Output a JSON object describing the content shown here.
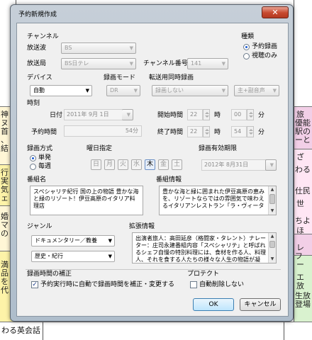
{
  "background": {
    "left_cells": [
      "神",
      "ヌ",
      "首",
      "、",
      "結",
      "行",
      "実",
      "気",
      "ェ",
      "婚",
      "マ",
      "の",
      "満",
      "品",
      "を",
      "代"
    ],
    "right_cells": [
      "旅",
      "優能",
      "駅の",
      "ーと",
      "ざ",
      "わる",
      "仕民",
      "世",
      "ちよ",
      "ほ",
      "レ",
      "フ",
      "ー",
      "エ",
      "放",
      "生放",
      "登場"
    ],
    "footer": "わる英会話"
  },
  "dialog": {
    "title": "予約新規作成",
    "close_label": "✕",
    "channel": {
      "group_label": "チャンネル",
      "broadcast_wave_label": "放送波",
      "broadcast_wave_value": "BS",
      "station_label": "放送局",
      "station_value": "BS日テレ",
      "channel_number_label": "チャンネル番号",
      "channel_number_value": "141"
    },
    "kind": {
      "group_label": "種類",
      "options": [
        "予約録画",
        "視聴のみ"
      ],
      "selected": 0
    },
    "device": {
      "group_label": "デバイス",
      "value": "自動"
    },
    "record_mode": {
      "group_label": "録画モード",
      "value": "DR"
    },
    "transfer": {
      "group_label": "転送用同時録画",
      "value": "録画しない",
      "audio_value": "主+副音声"
    },
    "time": {
      "group_label": "時刻",
      "date_label": "日付",
      "date_value": "2011年 9月 1日",
      "start_label": "開始時間",
      "start_hour": "22",
      "start_minute": "00",
      "hour_unit": "時",
      "minute_unit": "分",
      "duration_label": "予約時間",
      "duration_value": "54分",
      "end_label": "終了時間",
      "end_hour": "22",
      "end_minute": "54"
    },
    "record_method": {
      "group_label": "録画方式",
      "options": [
        "単発",
        "毎週"
      ],
      "selected": 0
    },
    "weekday": {
      "group_label": "曜日指定",
      "days": [
        "日",
        "月",
        "火",
        "水",
        "木",
        "金",
        "土"
      ],
      "selected": 4
    },
    "expiry": {
      "group_label": "録画有効期限",
      "value": "2012年 8月31日"
    },
    "program_name": {
      "group_label": "番組名",
      "text": "スペシャリテ紀行 国の上の物語 豊かな海と緑のリゾート！伊豆高原のイタリア料理店"
    },
    "program_info": {
      "group_label": "番組情報",
      "text": "豊かな海と緑に囲まれた伊豆高原の恵みを、リゾートならではの雰囲気で味わえるイタリアンレストラン「ラ・ヴィータ"
    },
    "genre": {
      "group_label": "ジャンル",
      "genre1": "ドキュメンタリー／教養",
      "genre2": "歴史・紀行"
    },
    "extended_info": {
      "group_label": "拡張情報",
      "text": "出演者旅人：高田延彦（格闘家・タレント）ナレーター：庄司永建番組内容「スペシャリテ」と呼ばれるシェフ自慢の特別料理には、食材を作る人、料理人、それを食する人たちの様々な人生の物語が凝"
    },
    "correction": {
      "group_label": "録画時間の補正",
      "checkbox_label": "予約実行時に自動で録画時間を補正・変更する",
      "checked": true
    },
    "protect": {
      "group_label": "プロテクト",
      "checkbox_label": "自動削除しない",
      "checked": false
    },
    "ok_label": "OK",
    "cancel_label": "キャンセル"
  }
}
